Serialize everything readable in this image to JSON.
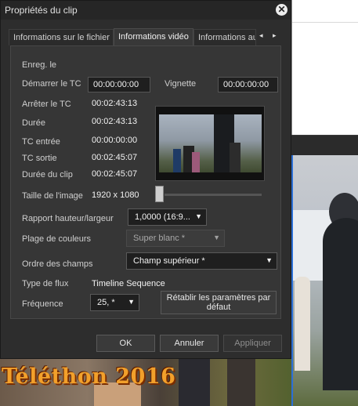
{
  "dialog": {
    "title": "Propriétés du clip",
    "close_glyph": "✕"
  },
  "tabs": [
    {
      "label": "Informations sur le fichier",
      "active": false
    },
    {
      "label": "Informations vidéo",
      "active": true
    },
    {
      "label": "Informations audio",
      "active": false
    }
  ],
  "tab_nav": {
    "left": "◂",
    "right": "▸"
  },
  "fields": {
    "enreg_label": "Enreg. le",
    "start_tc_label": "Démarrer le TC",
    "start_tc_value": "00:00:00:00",
    "vignette_label": "Vignette",
    "vignette_value": "00:00:00:00",
    "stop_tc_label": "Arrêter le TC",
    "stop_tc_value": "00:02:43:13",
    "duration_label": "Durée",
    "duration_value": "00:02:43:13",
    "tc_in_label": "TC entrée",
    "tc_in_value": "00:00:00:00",
    "tc_out_label": "TC sortie",
    "tc_out_value": "00:02:45:07",
    "clip_duration_label": "Durée du clip",
    "clip_duration_value": "00:02:45:07",
    "image_size_label": "Taille de l'image",
    "image_size_value": "1920 x 1080",
    "aspect_label": "Rapport hauteur/largeur",
    "aspect_value": "1,0000 (16:9...",
    "color_range_label": "Plage de couleurs",
    "color_range_value": "Super blanc *",
    "field_order_label": "Ordre des champs",
    "field_order_value": "Champ supérieur *",
    "stream_type_label": "Type de flux",
    "stream_type_value": "Timeline Sequence",
    "frequency_label": "Fréquence",
    "frequency_value": "25, *",
    "reset_button": "Rétablir les paramètres par défaut"
  },
  "thumbnail_slider": {
    "position": 0
  },
  "dropdown_arrow": "▼",
  "footer": {
    "ok": "OK",
    "cancel": "Annuler",
    "apply": "Appliquer"
  },
  "background": {
    "video_title": "Téléthon 2016"
  },
  "colors": {
    "dialog_bg": "#2d2d2d",
    "panel_bg": "#363636",
    "title_orange": "#f2a02b",
    "selection_blue": "#2b6fd6"
  }
}
